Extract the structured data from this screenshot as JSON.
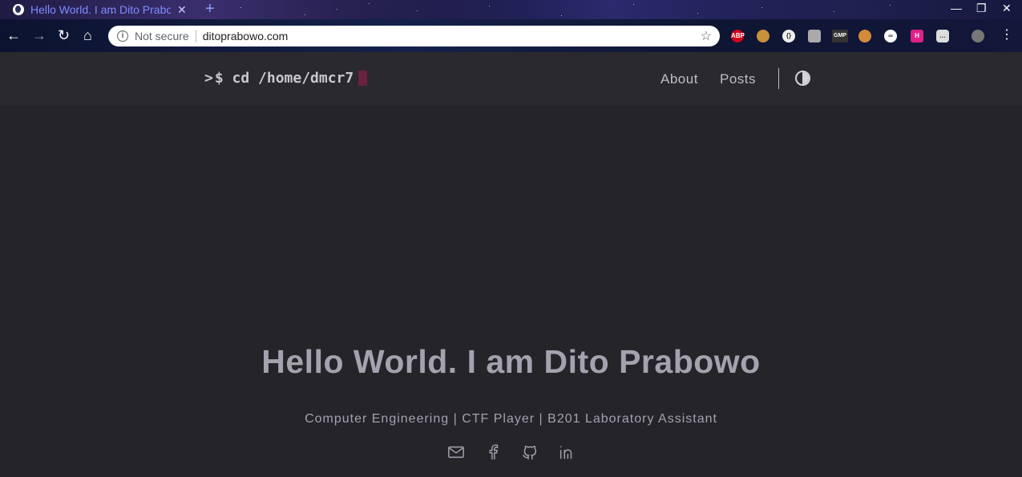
{
  "browser": {
    "tab_title": "Hello World. I am Dito Prabowo",
    "tab_close": "✕",
    "new_tab": "+",
    "security_label": "Not secure",
    "url": "ditoprabowo.com",
    "extensions": [
      "ABP",
      "cookie",
      "json",
      "ext",
      "GMP",
      "cookie2",
      "link",
      "H",
      "chat",
      "avatar"
    ]
  },
  "site": {
    "logo_prompt": ">",
    "logo_text": "$ cd /home/dmcr7",
    "nav": [
      {
        "label": "About"
      },
      {
        "label": "Posts"
      }
    ],
    "theme_toggle_icon": "contrast-icon"
  },
  "hero": {
    "title": "Hello World. I am Dito Prabowo",
    "subtitle": "Computer Engineering | CTF Player | B201 Laboratory Assistant",
    "socials": [
      "mail-icon",
      "facebook-icon",
      "github-icon",
      "linkedin-icon"
    ]
  },
  "colors": {
    "page_bg": "#252429",
    "header_bg": "#2a292e",
    "text": "#a3a2ae",
    "cursor": "#6b2140",
    "tab_text": "#7d8cff"
  }
}
